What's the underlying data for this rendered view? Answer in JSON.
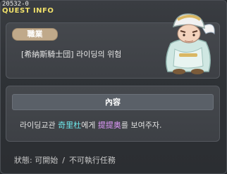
{
  "quest": {
    "id": "20532-0",
    "header": "QUEST INFO"
  },
  "job": {
    "label": "職業",
    "line": "[希納斯騎士団] 라이딩의 위험"
  },
  "content": {
    "label": "內容",
    "prefix": "라이딩교관 ",
    "npc": "奇里杜",
    "middle": "에게 ",
    "item": "提提奥",
    "suffix": "를 보여주자."
  },
  "status": {
    "label": "狀態:",
    "value": "可開始",
    "separator": "/",
    "extra": "不可執行任務"
  },
  "colors": {
    "title": "#f0e06a",
    "npc_highlight": "#6de7ea",
    "item_highlight": "#e39cff",
    "pill": "#c0a98a"
  },
  "icons": {
    "npc_portrait": "npc-character-icon"
  }
}
